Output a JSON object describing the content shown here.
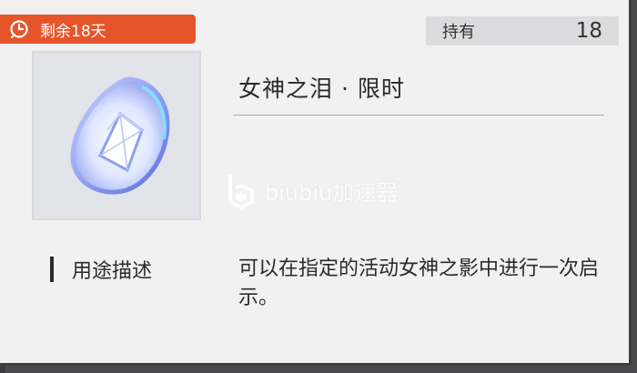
{
  "badge": {
    "icon": "clock-icon",
    "text": "剩余18天",
    "color": "#e8542a"
  },
  "holding": {
    "label": "持有",
    "count": "18"
  },
  "item": {
    "name": "女神之泪 · 限时",
    "icon": "teardrop-crystal-icon"
  },
  "watermark": {
    "text": "biubiu加速器",
    "icon": "biubiu-logo-icon"
  },
  "description": {
    "title": "用途描述",
    "text": "可以在指定的活动女神之影中进行一次启示。"
  }
}
